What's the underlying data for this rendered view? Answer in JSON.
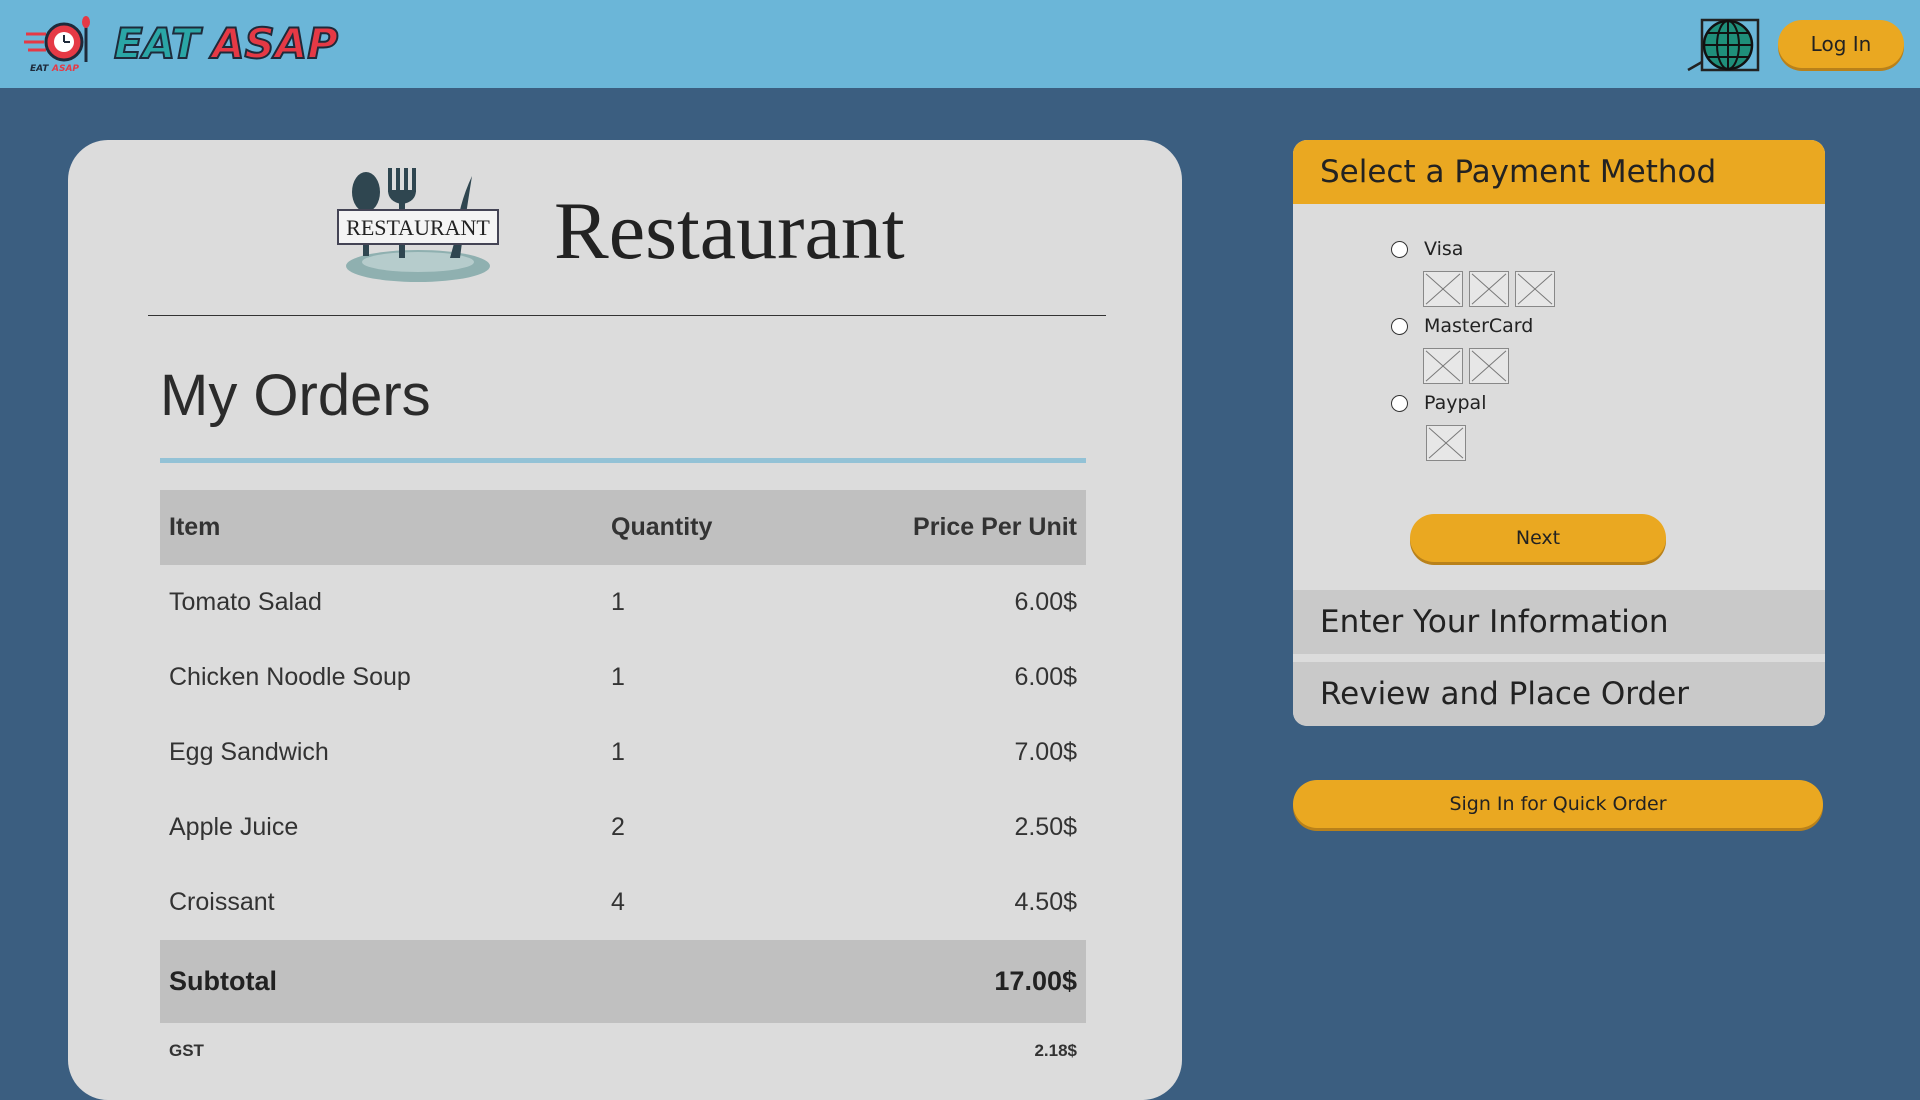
{
  "header": {
    "brand": "EAT ASAP",
    "login_label": "Log In",
    "language_icon": "globe-icon"
  },
  "restaurant": {
    "logo_text": "RESTAURANT",
    "title": "Restaurant"
  },
  "orders": {
    "title": "My Orders",
    "columns": [
      "Item",
      "Quantity",
      "Price Per Unit"
    ],
    "rows": [
      {
        "item": "Tomato Salad",
        "quantity": "1",
        "price": "6.00$"
      },
      {
        "item": "Chicken Noodle Soup",
        "quantity": "1",
        "price": "6.00$"
      },
      {
        "item": "Egg Sandwich",
        "quantity": "1",
        "price": "7.00$"
      },
      {
        "item": "Apple Juice",
        "quantity": "2",
        "price": "2.50$"
      },
      {
        "item": "Croissant",
        "quantity": "4",
        "price": "4.50$"
      }
    ],
    "subtotal_label": "Subtotal",
    "subtotal_value": "17.00$",
    "gst_label": "GST",
    "gst_value": "2.18$"
  },
  "payment": {
    "title": "Select a Payment Method",
    "options": [
      {
        "label": "Visa",
        "images": 3
      },
      {
        "label": "MasterCard",
        "images": 2
      },
      {
        "label": "Paypal",
        "images": 1
      }
    ],
    "next_label": "Next",
    "step2": "Enter Your Information",
    "step3": "Review and Place Order"
  },
  "quick_order_label": "Sign In for Quick Order",
  "colors": {
    "topbar": "#6bb6d8",
    "background": "#3b5e80",
    "accent": "#eaa821",
    "card": "#dcdcdc"
  }
}
